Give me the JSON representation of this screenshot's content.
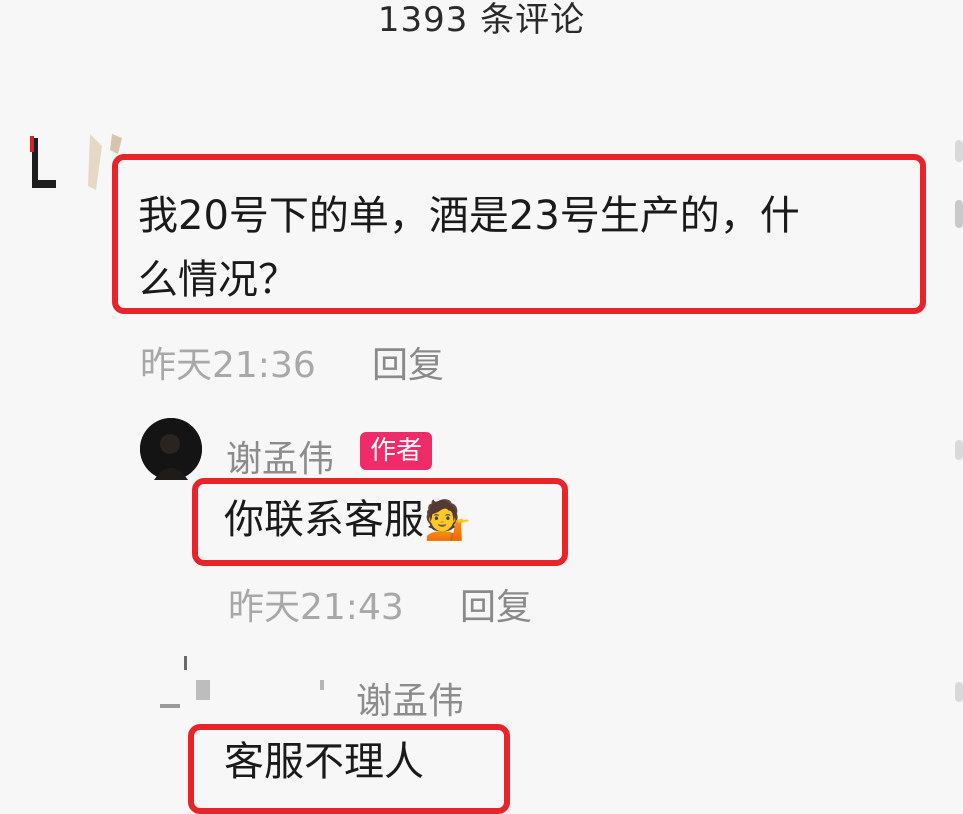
{
  "header": {
    "title": "1393 条评论"
  },
  "comments": [
    {
      "text": "我20号下的单，酒是23号生产的，什么情况？",
      "text_line1": "我20号下的单，酒是23号生产的，什",
      "text_line2": "么情况？",
      "time": "昨天21:36",
      "reply_label": "回复"
    }
  ],
  "replies": [
    {
      "username": "谢孟伟",
      "badge": "作者",
      "text": "你联系客服",
      "emoji": "💁",
      "time": "昨天21:43",
      "reply_label": "回复"
    },
    {
      "username": "谢孟伟",
      "text": "客服不理人"
    }
  ],
  "colors": {
    "highlight_border": "#e8232a",
    "author_badge": "#ef2b6a",
    "meta_text": "#a8a8a8"
  }
}
